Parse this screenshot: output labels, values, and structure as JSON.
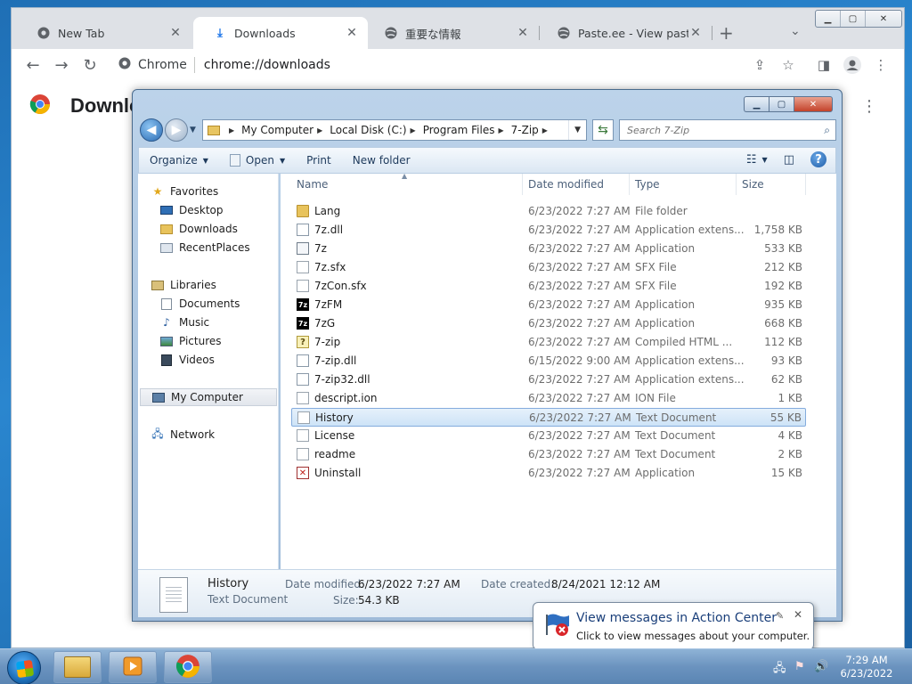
{
  "chrome": {
    "tabs": [
      {
        "label": "New Tab",
        "icon": "chrome-icon",
        "active": false
      },
      {
        "label": "Downloads",
        "icon": "download-icon",
        "active": true
      },
      {
        "label": "重要な情報",
        "icon": "globe-icon",
        "active": false
      },
      {
        "label": "Paste.ee - View paste m",
        "icon": "globe-icon",
        "active": false
      }
    ],
    "new_tab_label": "+",
    "omnibox": {
      "site_label": "Chrome",
      "url": "chrome://downloads"
    },
    "page_title": "Downlo"
  },
  "explorer": {
    "address": {
      "crumbs": [
        "My Computer",
        "Local Disk (C:)",
        "Program Files",
        "7-Zip"
      ]
    },
    "search_placeholder": "Search 7-Zip",
    "commands": {
      "organize": "Organize",
      "open": "Open",
      "print": "Print",
      "new_folder": "New folder"
    },
    "nav": {
      "favorites": "Favorites",
      "favorites_items": [
        "Desktop",
        "Downloads",
        "RecentPlaces"
      ],
      "libraries": "Libraries",
      "libraries_items": [
        "Documents",
        "Music",
        "Pictures",
        "Videos"
      ],
      "computer": "My Computer",
      "network": "Network"
    },
    "columns": {
      "name": "Name",
      "date": "Date modified",
      "type": "Type",
      "size": "Size"
    },
    "files": [
      {
        "name": "Lang",
        "date": "6/23/2022 7:27 AM",
        "type": "File folder",
        "size": "",
        "icon": "folder"
      },
      {
        "name": "7z.dll",
        "date": "6/23/2022 7:27 AM",
        "type": "Application extens...",
        "size": "1,758 KB",
        "icon": "dll"
      },
      {
        "name": "7z",
        "date": "6/23/2022 7:27 AM",
        "type": "Application",
        "size": "533 KB",
        "icon": "app"
      },
      {
        "name": "7z.sfx",
        "date": "6/23/2022 7:27 AM",
        "type": "SFX File",
        "size": "212 KB",
        "icon": "file"
      },
      {
        "name": "7zCon.sfx",
        "date": "6/23/2022 7:27 AM",
        "type": "SFX File",
        "size": "192 KB",
        "icon": "file"
      },
      {
        "name": "7zFM",
        "date": "6/23/2022 7:27 AM",
        "type": "Application",
        "size": "935 KB",
        "icon": "7z"
      },
      {
        "name": "7zG",
        "date": "6/23/2022 7:27 AM",
        "type": "Application",
        "size": "668 KB",
        "icon": "7z"
      },
      {
        "name": "7-zip",
        "date": "6/23/2022 7:27 AM",
        "type": "Compiled HTML ...",
        "size": "112 KB",
        "icon": "help"
      },
      {
        "name": "7-zip.dll",
        "date": "6/15/2022 9:00 AM",
        "type": "Application extens...",
        "size": "93 KB",
        "icon": "dll"
      },
      {
        "name": "7-zip32.dll",
        "date": "6/23/2022 7:27 AM",
        "type": "Application extens...",
        "size": "62 KB",
        "icon": "dll"
      },
      {
        "name": "descript.ion",
        "date": "6/23/2022 7:27 AM",
        "type": "ION File",
        "size": "1 KB",
        "icon": "file"
      },
      {
        "name": "History",
        "date": "6/23/2022 7:27 AM",
        "type": "Text Document",
        "size": "55 KB",
        "icon": "file",
        "selected": true
      },
      {
        "name": "License",
        "date": "6/23/2022 7:27 AM",
        "type": "Text Document",
        "size": "4 KB",
        "icon": "file"
      },
      {
        "name": "readme",
        "date": "6/23/2022 7:27 AM",
        "type": "Text Document",
        "size": "2 KB",
        "icon": "file"
      },
      {
        "name": "Uninstall",
        "date": "6/23/2022 7:27 AM",
        "type": "Application",
        "size": "15 KB",
        "icon": "unin"
      }
    ],
    "details": {
      "name": "History",
      "type": "Text Document",
      "modified_label": "Date modified:",
      "modified": "6/23/2022 7:27 AM",
      "size_label": "Size:",
      "size": "54.3 KB",
      "created_label": "Date created:",
      "created": "8/24/2021 12:12 AM"
    }
  },
  "notification": {
    "title": "View messages in Action Center",
    "text": "Click to view messages about your computer."
  },
  "taskbar": {
    "time": "7:29 AM",
    "date": "6/23/2022"
  },
  "colors": {
    "accent": "#2a6bb3",
    "selection": "#cde3f7",
    "taskbar": "#6b93bf"
  }
}
